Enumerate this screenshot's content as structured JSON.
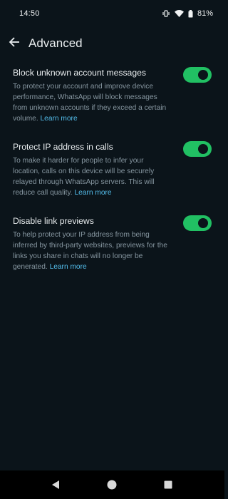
{
  "status_bar": {
    "time": "14:50",
    "battery": "81%",
    "icons": [
      "vibrate-icon",
      "wifi-icon",
      "battery-icon"
    ]
  },
  "header": {
    "title": "Advanced",
    "back_icon": "arrow-left-icon"
  },
  "settings": [
    {
      "title": "Block unknown account messages",
      "description": "To protect your account and improve device performance, WhatsApp will block messages from unknown accounts if they exceed a certain volume.",
      "link": "Learn more",
      "enabled": true
    },
    {
      "title": "Protect IP address in calls",
      "description": "To make it harder for people to infer your location, calls on this device will be securely relayed through WhatsApp servers. This will reduce call quality.",
      "link": "Learn more",
      "enabled": true
    },
    {
      "title": "Disable link previews",
      "description": "To help protect your IP address from being inferred by third-party websites, previews for the links you share in chats will no longer be generated.",
      "link": "Learn more",
      "enabled": true
    }
  ],
  "nav_bar": {
    "buttons": [
      "back-triangle-icon",
      "home-circle-icon",
      "recents-square-icon"
    ]
  },
  "colors": {
    "background": "#0b141a",
    "accent_green": "#21c063",
    "link_blue": "#53bdeb",
    "secondary_text": "#8696a0"
  }
}
